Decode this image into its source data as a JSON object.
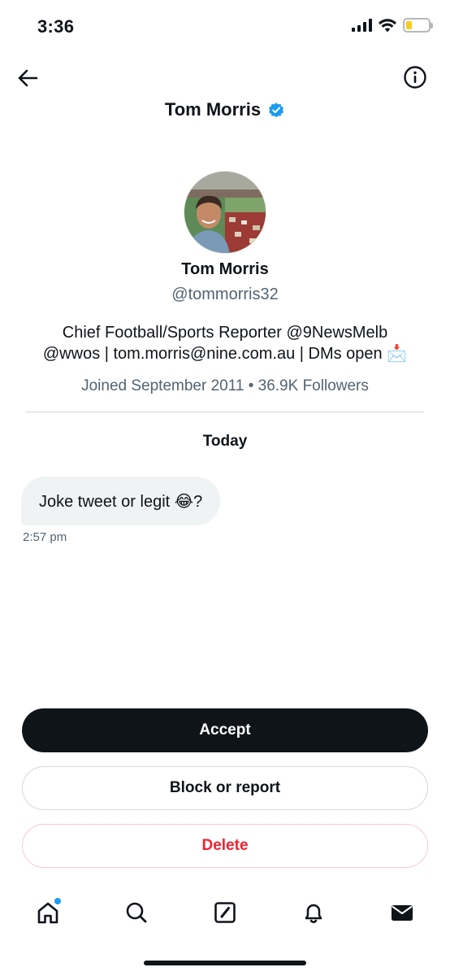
{
  "status_bar": {
    "time": "3:36",
    "battery_level": 0.25,
    "battery_color": "#f7cd1c"
  },
  "header": {
    "title": "Tom Morris",
    "back_icon": "arrow-left-icon",
    "info_icon": "info-circle-icon",
    "verified_icon": "verified-badge-icon",
    "verified_color": "#1d9bf0"
  },
  "profile": {
    "name": "Tom Morris",
    "handle": "@tommorris32",
    "bio_line1": "Chief Football/Sports Reporter @9NewsMelb",
    "bio_line2": "@wwos | tom.morris@nine.com.au | DMs open 📩",
    "meta": "Joined September 2011 • 36.9K Followers"
  },
  "conversation": {
    "day_label": "Today",
    "messages": [
      {
        "text": "Joke tweet or legit 😂?",
        "time": "2:57 pm"
      }
    ]
  },
  "actions": {
    "accept_label": "Accept",
    "block_label": "Block or report",
    "delete_label": "Delete",
    "delete_color": "#f4212e"
  },
  "tab_bar": {
    "items": [
      {
        "icon": "home-icon",
        "has_notification": true
      },
      {
        "icon": "search-icon"
      },
      {
        "icon": "compose-icon"
      },
      {
        "icon": "bell-icon"
      },
      {
        "icon": "mail-icon"
      }
    ],
    "notification_color": "#1d9bf0"
  }
}
